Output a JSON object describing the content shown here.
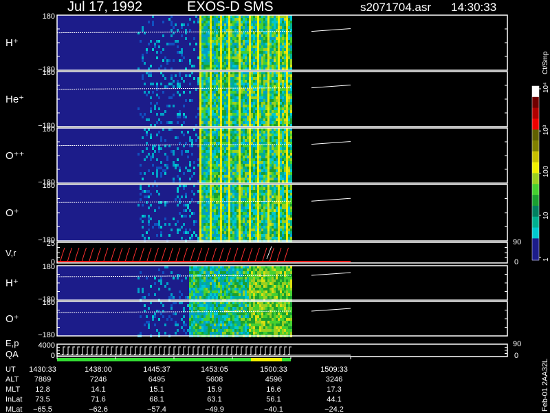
{
  "header": {
    "date": "Jul 17, 1992",
    "instrument": "EXOS-D SMS",
    "file": "s2071704.asr",
    "time": "14:30:33"
  },
  "colorbar": {
    "unit": "Ct/Smp",
    "ticks": [
      {
        "label": "1",
        "value": 1
      },
      {
        "label": "10",
        "value": 10
      },
      {
        "label": "100",
        "value": 100
      },
      {
        "label": "10³",
        "value": 1000
      },
      {
        "label": "10⁴",
        "value": 10000
      }
    ],
    "colors": [
      "#1c1c8a",
      "#00c8d0",
      "#00b090",
      "#1aa030",
      "#46d030",
      "#9ad020",
      "#f0f000",
      "#a09000",
      "#606000",
      "#f00000",
      "#b00000",
      "#700000",
      "#ffffff"
    ]
  },
  "side_code": "Feb-01 2AA32L",
  "chart_data": {
    "type": "heatmap",
    "x_time_labels": [
      "1430:33",
      "1438:00",
      "1445:37",
      "1453:05",
      "1500:33",
      "1509:33"
    ],
    "panels": [
      {
        "name": "H⁺",
        "ymax": "180",
        "ymin": "−180",
        "data_end": 0.38
      },
      {
        "name": "He⁺",
        "ymax": "180",
        "ymin": "−180",
        "data_end": 0.38
      },
      {
        "name": "O⁺⁺",
        "ymax": "180",
        "ymin": "−180",
        "data_end": 0.38
      },
      {
        "name": "O⁺",
        "ymax": "180",
        "ymin": "−180",
        "data_end": 0.38
      },
      {
        "name": "V,r",
        "ymax": "25",
        "ymin": "0",
        "right_max": "90",
        "right_min": "0"
      },
      {
        "name": "H⁺",
        "ymax": "180",
        "ymin": "−180"
      },
      {
        "name": "O⁺",
        "ymax": "180",
        "ymin": "−180"
      },
      {
        "name": "E,p",
        "extra": "QA",
        "ymax": "4000",
        "ymin": "0",
        "right_max": "90",
        "right_min": "0"
      }
    ],
    "orbit_table": [
      {
        "label": "UT",
        "values": [
          "1430:33",
          "1438:00",
          "1445:37",
          "1453:05",
          "1500:33",
          "1509:33"
        ]
      },
      {
        "label": "ALT",
        "values": [
          "7869",
          "7246",
          "6495",
          "5608",
          "4596",
          "3246"
        ]
      },
      {
        "label": "MLT",
        "values": [
          "12.8",
          "14.1",
          "15.1",
          "15.9",
          "16.6",
          "17.3"
        ]
      },
      {
        "label": "InLat",
        "values": [
          "73.5",
          "71.6",
          "68.1",
          "63.1",
          "56.1",
          "44.1"
        ]
      },
      {
        "label": "MLat",
        "values": [
          "−65.5",
          "−62.6",
          "−57.4",
          "−49.9",
          "−40.1",
          "−24.2"
        ]
      }
    ]
  }
}
